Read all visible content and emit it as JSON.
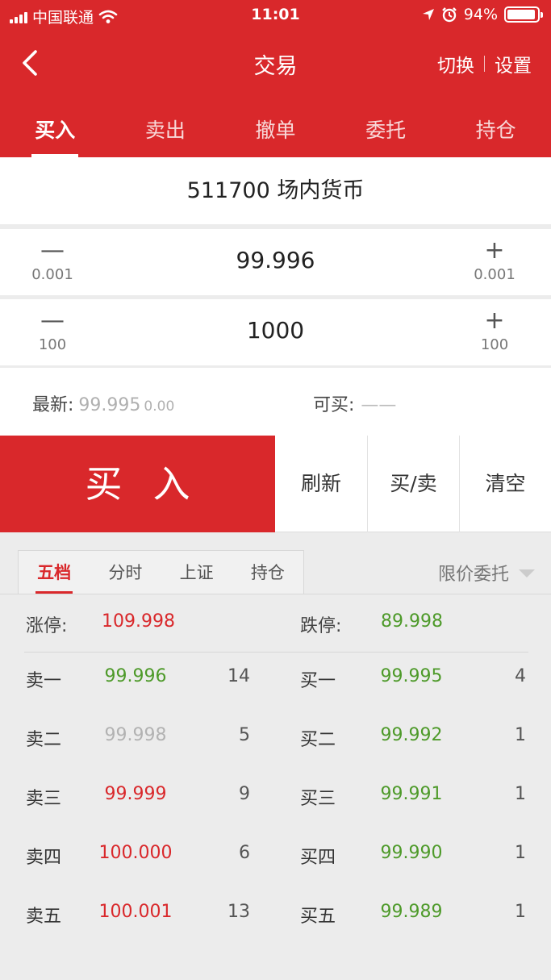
{
  "status_bar": {
    "carrier": "中国联通",
    "time": "11:01",
    "battery": "94%",
    "battery_level": 0.94,
    "icons": [
      "signal-icon",
      "wifi-icon",
      "location-icon",
      "alarm-icon",
      "battery-icon"
    ]
  },
  "nav": {
    "back_icon": "chevron-left-icon",
    "title": "交易",
    "switch_label": "切换",
    "settings_label": "设置"
  },
  "tabs": [
    {
      "label": "买入",
      "active": true
    },
    {
      "label": "卖出",
      "active": false
    },
    {
      "label": "撤单",
      "active": false
    },
    {
      "label": "委托",
      "active": false
    },
    {
      "label": "持仓",
      "active": false
    }
  ],
  "stock": {
    "name": "511700 场内货币"
  },
  "price_stepper": {
    "minus": "—",
    "plus": "+",
    "step_left": "0.001",
    "step_right": "0.001",
    "value": "99.996"
  },
  "qty_stepper": {
    "minus": "—",
    "plus": "+",
    "step_left": "100",
    "step_right": "100",
    "value": "1000"
  },
  "info": {
    "latest_label": "最新:",
    "latest_price": "99.995",
    "latest_change": "0.00",
    "buyable_label": "可买:",
    "buyable_value": "——"
  },
  "actions": {
    "buy": "买入",
    "refresh": "刷新",
    "buy_sell": "买/卖",
    "clear": "清空"
  },
  "quote_tabs": [
    {
      "label": "五档",
      "active": true
    },
    {
      "label": "分时",
      "active": false
    },
    {
      "label": "上证",
      "active": false
    },
    {
      "label": "持仓",
      "active": false
    }
  ],
  "order_type": {
    "label": "限价委托",
    "icon": "dropdown-caret-icon"
  },
  "limits": {
    "up_label": "涨停:",
    "up_value": "109.998",
    "down_label": "跌停:",
    "down_value": "89.998"
  },
  "colors": {
    "brand_red": "#d9282b",
    "up_red": "#d9282b",
    "down_green": "#4e9a2a",
    "neutral_gray": "#b2b2b2"
  },
  "order_book": {
    "sell": [
      {
        "label": "卖一",
        "price": "99.996",
        "qty": "14",
        "tone": "green"
      },
      {
        "label": "卖二",
        "price": "99.998",
        "qty": "5",
        "tone": "gray"
      },
      {
        "label": "卖三",
        "price": "99.999",
        "qty": "9",
        "tone": "red"
      },
      {
        "label": "卖四",
        "price": "100.000",
        "qty": "6",
        "tone": "red"
      },
      {
        "label": "卖五",
        "price": "100.001",
        "qty": "13",
        "tone": "red"
      }
    ],
    "buy": [
      {
        "label": "买一",
        "price": "99.995",
        "qty": "4",
        "tone": "green"
      },
      {
        "label": "买二",
        "price": "99.992",
        "qty": "1",
        "tone": "green"
      },
      {
        "label": "买三",
        "price": "99.991",
        "qty": "1",
        "tone": "green"
      },
      {
        "label": "买四",
        "price": "99.990",
        "qty": "1",
        "tone": "green"
      },
      {
        "label": "买五",
        "price": "99.989",
        "qty": "1",
        "tone": "green"
      }
    ]
  }
}
